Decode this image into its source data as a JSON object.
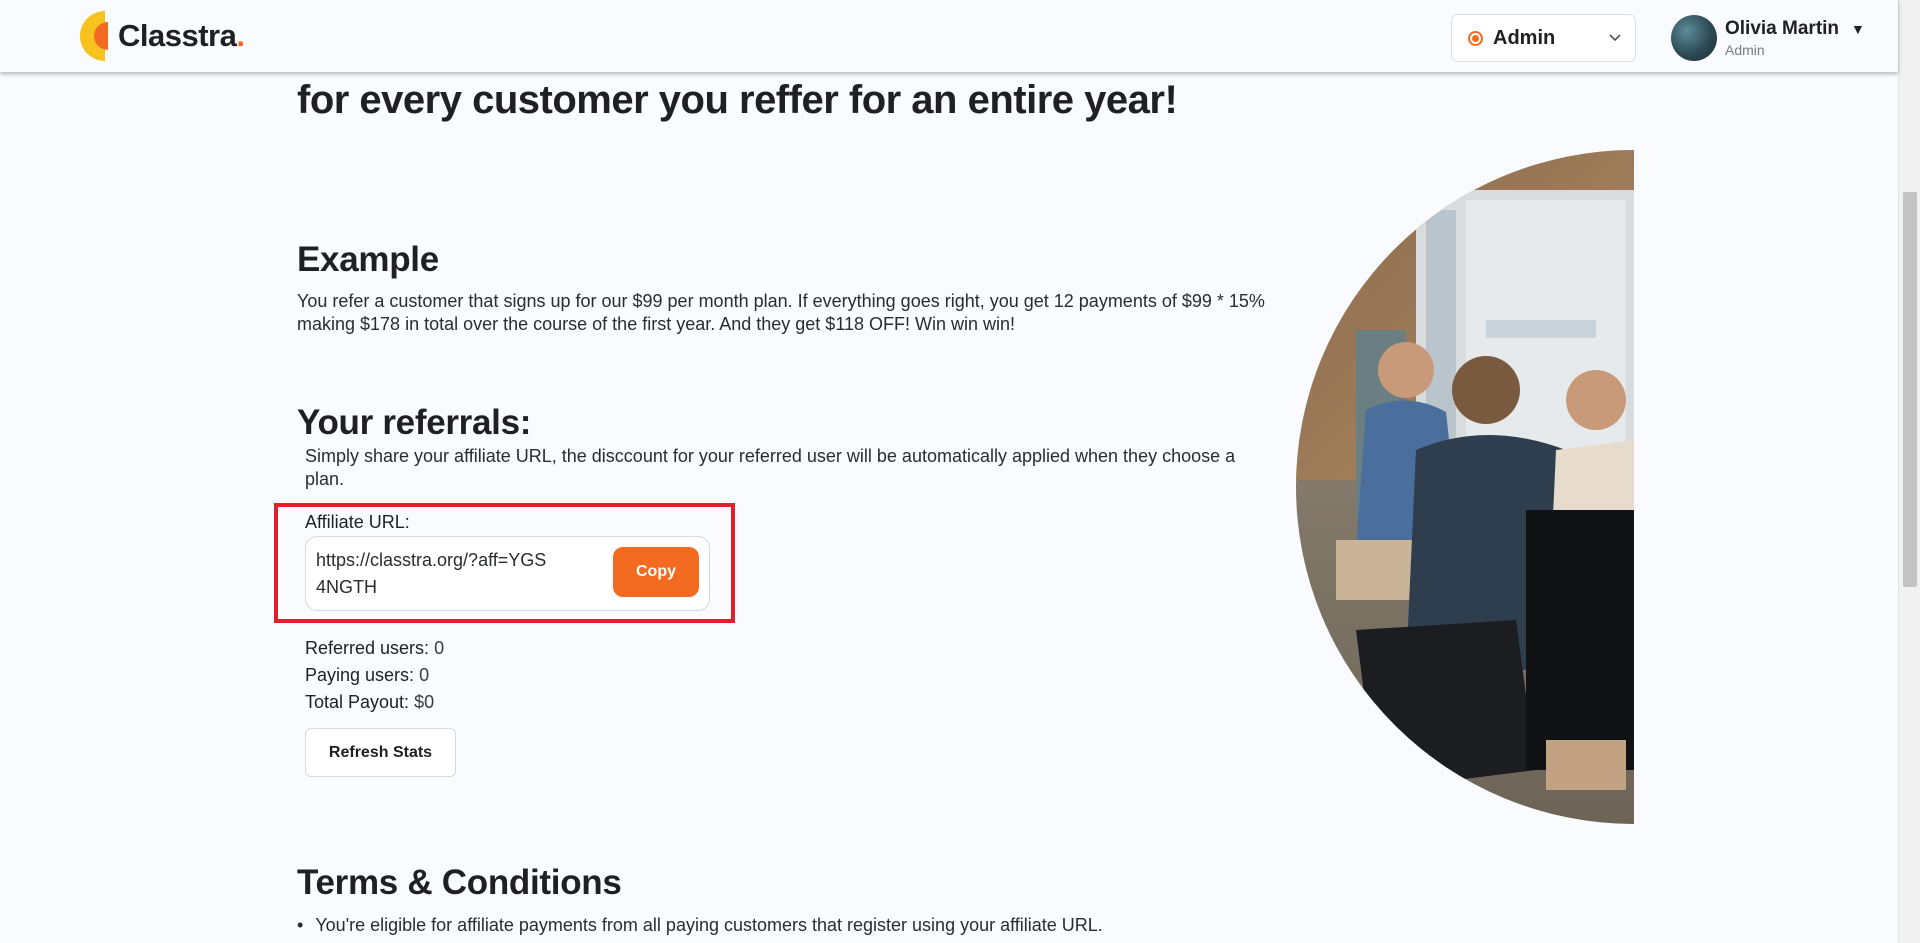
{
  "header": {
    "brand": "Classtra",
    "brand_suffix": ".",
    "role_select": {
      "value": "Admin"
    },
    "user": {
      "name": "Olivia Martin",
      "role": "Admin"
    }
  },
  "main": {
    "headline": "for every customer you reffer for an entire year!",
    "example": {
      "title": "Example",
      "body": "You refer a customer that signs up for our $99 per month plan. If everything goes right, you get 12 payments of $99 * 15% making $178 in total over the course of the first year. And they get $118 OFF! Win win win!"
    },
    "referrals": {
      "title": "Your referrals:",
      "description": "Simply share your affiliate URL, the disccount for your referred user will be automatically applied when they choose a plan.",
      "affiliate_label": "Affiliate URL:",
      "affiliate_url": "https://classtra.org/?aff=YGS4NGTH",
      "copy_label": "Copy",
      "stats": [
        {
          "label": "Referred users:",
          "value": "0"
        },
        {
          "label": "Paying users:",
          "value": "0"
        },
        {
          "label": "Total Payout:",
          "value": "$0"
        }
      ],
      "refresh_label": "Refresh Stats"
    },
    "terms": {
      "title": "Terms & Conditions",
      "items": [
        "You're eligible for affiliate payments from all paying customers that register using your affiliate URL."
      ]
    }
  },
  "colors": {
    "accent": "#f26b21",
    "logo_yellow": "#f7c21b",
    "highlight": "#e0202a",
    "text": "#1f1f24"
  },
  "icons": {
    "role_status": "radio-dot-icon",
    "role_dropdown": "chevron-down-icon",
    "user_dropdown": "caret-down-icon"
  }
}
